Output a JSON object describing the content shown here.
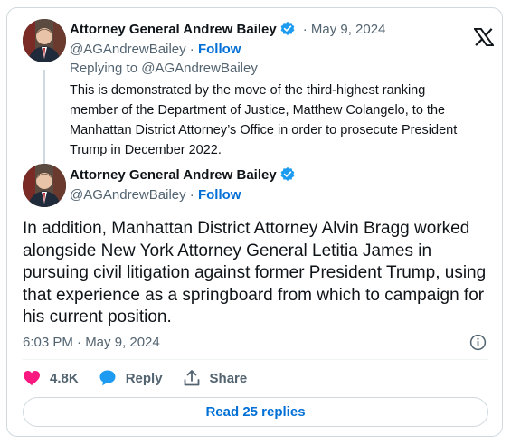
{
  "parent_tweet": {
    "author_name": "Attorney General Andrew Bailey",
    "date": "· May 9, 2024",
    "handle": "@AGAndrewBailey",
    "follow_label": "Follow",
    "separator": " · ",
    "replying_to": "Replying to @AGAndrewBailey",
    "text": "This is demonstrated by the move of the third-highest ranking member of the Department of Justice, Matthew Colangelo, to the Manhattan District Attorney’s Office in order to prosecute President Trump in December 2022."
  },
  "main_tweet": {
    "author_name": "Attorney General Andrew Bailey",
    "handle": "@AGAndrewBailey",
    "follow_label": "Follow",
    "separator": " · ",
    "text": "In addition, Manhattan District Attorney Alvin Bragg worked alongside New York Attorney General Letitia James in pursuing civil litigation against former President Trump, using that experience as a springboard from which to campaign for his current position.",
    "timestamp": "6:03 PM · May 9, 2024"
  },
  "actions": {
    "likes": "4.8K",
    "reply_label": "Reply",
    "share_label": "Share"
  },
  "read_replies_label": "Read 25 replies",
  "icons": {
    "like": "heart-icon",
    "reply": "speech-bubble-icon",
    "share": "share-upload-icon",
    "info": "info-icon",
    "brand": "x-logo-icon",
    "verified": "verified-badge-icon"
  },
  "colors": {
    "like": "#f91880",
    "reply": "#1d9bf0",
    "link": "#006fd6",
    "verified": "#1d9bf0",
    "muted": "#536471"
  }
}
